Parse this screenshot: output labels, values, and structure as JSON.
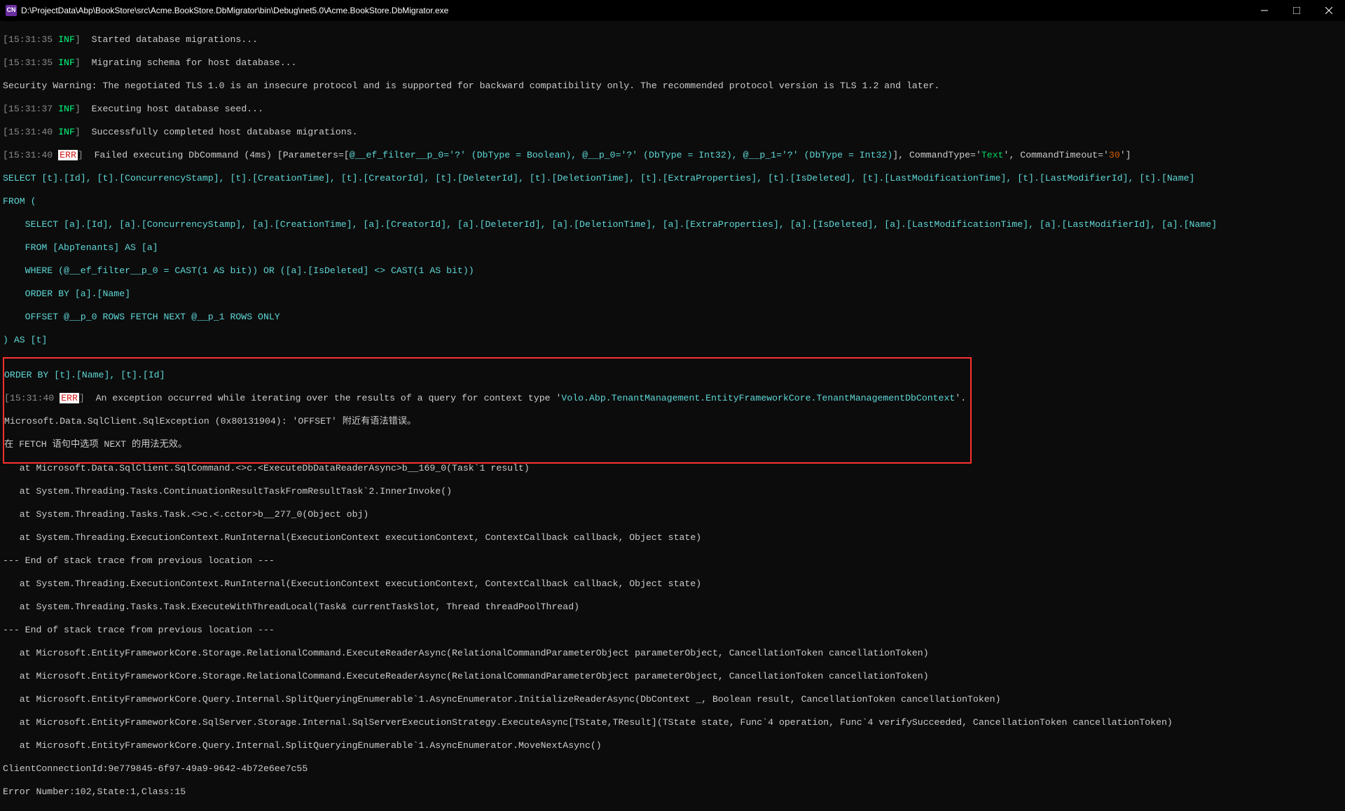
{
  "title_bar": {
    "icon_text": "CN",
    "path": "D:\\ProjectData\\Abp\\BookStore\\src\\Acme.BookStore.DbMigrator\\bin\\Debug\\net5.0\\Acme.BookStore.DbMigrator.exe"
  },
  "log": {
    "l1_ts": "[15:31:35 ",
    "l1_inf": "INF",
    "l1_cb": "]  ",
    "l1_msg": "Started database migrations...",
    "l2_ts": "[15:31:35 ",
    "l2_inf": "INF",
    "l2_cb": "]  ",
    "l2_msg": "Migrating schema for host database...",
    "l3_msg": "Security Warning: The negotiated TLS 1.0 is an insecure protocol and is supported for backward compatibility only. The recommended protocol version is TLS 1.2 and later.",
    "l4_ts": "[15:31:37 ",
    "l4_inf": "INF",
    "l4_cb": "]  ",
    "l4_msg": "Executing host database seed...",
    "l5_ts": "[15:31:40 ",
    "l5_inf": "INF",
    "l5_cb": "]  ",
    "l5_msg": "Successfully completed host database migrations.",
    "l6_ts": "[15:31:40 ",
    "l6_err": "ERR",
    "l6_cb": "]  ",
    "l6_a": "Failed executing DbCommand (",
    "l6_b": "4ms",
    "l6_c": ") [Parameters=[",
    "l6_d": "@__ef_filter__p_0='?' (DbType = Boolean), @__p_0='?' (DbType = Int32), @__p_1='?' (DbType = Int32)",
    "l6_e": "], CommandType='",
    "l6_f": "Text",
    "l6_g": "', CommandTimeout='",
    "l6_h": "30",
    "l6_i": "']",
    "sql1": "SELECT [t].[Id], [t].[ConcurrencyStamp], [t].[CreationTime], [t].[CreatorId], [t].[DeleterId], [t].[DeletionTime], [t].[ExtraProperties], [t].[IsDeleted], [t].[LastModificationTime], [t].[LastModifierId], [t].[Name]",
    "sql2": "FROM (",
    "sql3": "    SELECT [a].[Id], [a].[ConcurrencyStamp], [a].[CreationTime], [a].[CreatorId], [a].[DeleterId], [a].[DeletionTime], [a].[ExtraProperties], [a].[IsDeleted], [a].[LastModificationTime], [a].[LastModifierId], [a].[Name]",
    "sql4": "    FROM [AbpTenants] AS [a]",
    "sql5": "    WHERE (@__ef_filter__p_0 = CAST(1 AS bit)) OR ([a].[IsDeleted] <> CAST(1 AS bit))",
    "sql6": "    ORDER BY [a].[Name]",
    "sql7": "    OFFSET @__p_0 ROWS FETCH NEXT @__p_1 ROWS ONLY",
    "sql8": ") AS [t]",
    "sql9": "ORDER BY [t].[Name], [t].[Id]",
    "ex_ts": "[15:31:40 ",
    "ex_err": "ERR",
    "ex_cb": "]  ",
    "ex_a": "An exception occurred while iterating over the results of a query for con",
    "ex_b": "text type '",
    "ex_c": "Volo.Abp.TenantManagement.EntityFrameworkCore.TenantManagementDbContext",
    "ex_d": "'.",
    "ex2": "Microsoft.Data.SqlClient.SqlException (0x80131904): 'OFFSET' 附近有语法错误。",
    "ex3": "在 FETCH 语句中选项 NEXT 的用法无效。",
    "st1": "   at Microsoft.Data.SqlClient.SqlCommand.<>c.<ExecuteDbDataReaderAsync>b__169_0(Task`1 result)",
    "st2": "   at System.Threading.Tasks.ContinuationResultTaskFromResultTask`2.InnerInvoke()",
    "st3": "   at System.Threading.Tasks.Task.<>c.<.cctor>b__277_0(Object obj)",
    "st4": "   at System.Threading.ExecutionContext.RunInternal(ExecutionContext executionContext, ContextCallback callback, Object state)",
    "st5": "--- End of stack trace from previous location ---",
    "st6": "   at System.Threading.ExecutionContext.RunInternal(ExecutionContext executionContext, ContextCallback callback, Object state)",
    "st7": "   at System.Threading.Tasks.Task.ExecuteWithThreadLocal(Task& currentTaskSlot, Thread threadPoolThread)",
    "st8": "--- End of stack trace from previous location ---",
    "st9": "   at Microsoft.EntityFrameworkCore.Storage.RelationalCommand.ExecuteReaderAsync(RelationalCommandParameterObject parameterObject, CancellationToken cancellationToken)",
    "st10": "   at Microsoft.EntityFrameworkCore.Storage.RelationalCommand.ExecuteReaderAsync(RelationalCommandParameterObject parameterObject, CancellationToken cancellationToken)",
    "st11": "   at Microsoft.EntityFrameworkCore.Query.Internal.SplitQueryingEnumerable`1.AsyncEnumerator.InitializeReaderAsync(DbContext _, Boolean result, CancellationToken cancellationToken)",
    "st12": "   at Microsoft.EntityFrameworkCore.SqlServer.Storage.Internal.SqlServerExecutionStrategy.ExecuteAsync[TState,TResult](TState state, Func`4 operation, Func`4 verifySucceeded, CancellationToken cancellationToken)",
    "st13": "   at Microsoft.EntityFrameworkCore.Query.Internal.SplitQueryingEnumerable`1.AsyncEnumerator.MoveNextAsync()",
    "cc": "ClientConnectionId:9e779845-6f97-49a9-9642-4b72e6ee7c55",
    "en": "Error Number:102,State:1,Class:15"
  }
}
